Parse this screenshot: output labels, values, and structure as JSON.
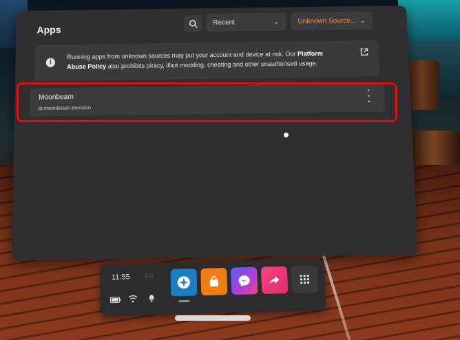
{
  "panel": {
    "title": "Apps",
    "sort_dropdown": "Recent",
    "source_dropdown": "Unknown Source...",
    "notice": {
      "text_before": "Running apps from unknown sources may put your account and device at risk. Our ",
      "link_text": "Platform Abuse Policy",
      "text_after": " also prohibits piracy, illicit modding, cheating and other unauthorised usage."
    },
    "apps": [
      {
        "name": "Moonbeam",
        "package": "ai.moonbeam.envision"
      }
    ]
  },
  "dock": {
    "time": "11:55",
    "time_ghost": "Fri"
  },
  "colors": {
    "panel_bg": "#2f2f31",
    "accent_orange": "#f28b4c",
    "highlight_red": "#e11010"
  },
  "icons": [
    "search-icon",
    "chevron-down-icon",
    "info-icon",
    "external-link-icon",
    "more-vert-icon",
    "battery-icon",
    "wifi-icon",
    "bell-icon",
    "explore-icon",
    "store-icon",
    "messenger-icon",
    "share-icon",
    "app-library-icon"
  ]
}
